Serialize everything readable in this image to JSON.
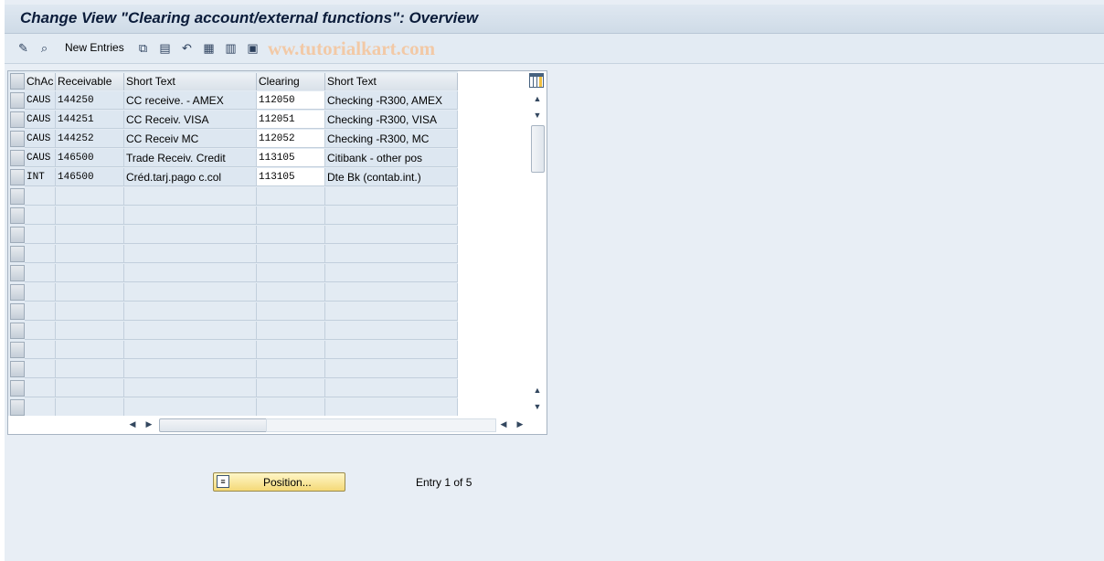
{
  "window": {
    "title": "Change View \"Clearing account/external functions\": Overview"
  },
  "toolbar": {
    "icons": [
      "edit-pencil-icon",
      "display-icon",
      "copy-icon",
      "delete-icon",
      "undo-icon",
      "select-all-icon",
      "select-block-icon",
      "deselect-all-icon"
    ],
    "new_entries_label": "New Entries",
    "watermark": "ww.tutorialkart.com"
  },
  "table": {
    "columns": [
      "ChAc",
      "Receivable",
      "Short Text",
      "Clearing",
      "Short Text"
    ],
    "rows": [
      [
        "CAUS",
        "144250",
        "CC receive. -  AMEX",
        "112050",
        "Checking -R300, AMEX"
      ],
      [
        "CAUS",
        "144251",
        "CC Receiv. VISA",
        "112051",
        "Checking -R300, VISA"
      ],
      [
        "CAUS",
        "144252",
        "CC Receiv MC",
        "112052",
        "Checking -R300, MC"
      ],
      [
        "CAUS",
        "146500",
        "Trade Receiv. Credit",
        "113105",
        "Citibank - other pos"
      ],
      [
        "INT",
        "146500",
        "Créd.tarj.pago c.col",
        "113105",
        "Dte Bk (contab.int.)"
      ]
    ],
    "empty_rows": 12
  },
  "footer": {
    "position_button": "Position...",
    "entry_text": "Entry 1 of 5"
  }
}
